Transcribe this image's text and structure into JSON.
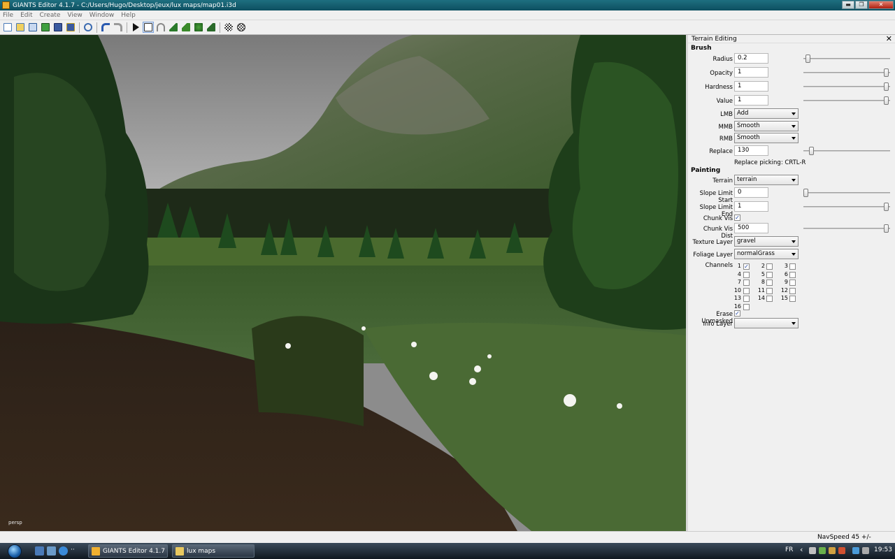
{
  "window": {
    "title": "GIANTS Editor 4.1.7 - C:/Users/Hugo/Desktop/jeux/lux maps/map01.i3d",
    "minimize": "▬",
    "maximize": "❐",
    "close": "✕"
  },
  "menu": [
    "File",
    "Edit",
    "Create",
    "View",
    "Window",
    "Help"
  ],
  "toolbar_icons": [
    "new-file-icon",
    "open-file-icon",
    "import-icon",
    "export-icon",
    "save-icon",
    "save-as-icon",
    "refresh-icon",
    "undo-icon",
    "redo-icon",
    "play-icon",
    "select-icon",
    "move-icon",
    "terrain-sculpt-icon",
    "terrain-paint-icon",
    "foliage-paint-icon",
    "terrain-detail-icon",
    "grid-icon",
    "snap-icon"
  ],
  "viewport": {
    "camera_label": "persp"
  },
  "panel": {
    "title": "Terrain Editing",
    "close": "✕",
    "brush_header": "Brush",
    "radius_label": "Radius",
    "radius_value": "0.2",
    "radius_level": 0.03,
    "opacity_label": "Opacity",
    "opacity_value": "1",
    "opacity_level": 1,
    "hardness_label": "Hardness",
    "hardness_value": "1",
    "hardness_level": 1,
    "value_label": "Value",
    "value_value": "1",
    "value_level": 1,
    "lmb_label": "LMB",
    "lmb_value": "Add",
    "mmb_label": "MMB",
    "mmb_value": "Smooth",
    "rmb_label": "RMB",
    "rmb_value": "Smooth",
    "replace_label": "Replace",
    "replace_value": "130",
    "replace_level": 0.07,
    "replace_hint": "Replace picking: CRTL-R",
    "painting_header": "Painting",
    "terrain_label": "Terrain",
    "terrain_value": "terrain",
    "slope_start_label": "Slope Limit Start",
    "slope_start_value": "0",
    "slope_start_level": 0,
    "slope_end_label": "Slope Limit End",
    "slope_end_value": "1",
    "slope_end_level": 1,
    "chunk_vis_label": "Chunk Vis",
    "chunk_vis_checked": true,
    "chunk_dist_label": "Chunk Vis Dist",
    "chunk_dist_value": "500",
    "chunk_dist_level": 1,
    "texture_layer_label": "Texture Layer",
    "texture_layer_value": "gravel",
    "foliage_layer_label": "Foliage Layer",
    "foliage_layer_value": "normalGrass",
    "channels_label": "Channels",
    "channels": [
      {
        "n": "1",
        "checked": true
      },
      {
        "n": "2",
        "checked": false
      },
      {
        "n": "3",
        "checked": false
      },
      {
        "n": "4",
        "checked": false
      },
      {
        "n": "5",
        "checked": false
      },
      {
        "n": "6",
        "checked": false
      },
      {
        "n": "7",
        "checked": false
      },
      {
        "n": "8",
        "checked": false
      },
      {
        "n": "9",
        "checked": false
      },
      {
        "n": "10",
        "checked": false
      },
      {
        "n": "11",
        "checked": false
      },
      {
        "n": "12",
        "checked": false
      },
      {
        "n": "13",
        "checked": false
      },
      {
        "n": "14",
        "checked": false
      },
      {
        "n": "15",
        "checked": false
      },
      {
        "n": "16",
        "checked": false
      }
    ],
    "erase_unmasked_label": "Erase Unmasked",
    "erase_unmasked_checked": true,
    "info_layer_label": "Info Layer",
    "info_layer_value": "",
    "checkmark": "✓"
  },
  "status": {
    "navspeed": "NavSpeed 45 +/-"
  },
  "taskbar": {
    "tasks": [
      {
        "label": "GIANTS Editor 4.1.7 ...",
        "color": "#f0b030"
      },
      {
        "label": "lux maps",
        "color": "#e8c860"
      }
    ],
    "lang": "FR",
    "tray_arrow": "‹",
    "clock": "19:53"
  }
}
